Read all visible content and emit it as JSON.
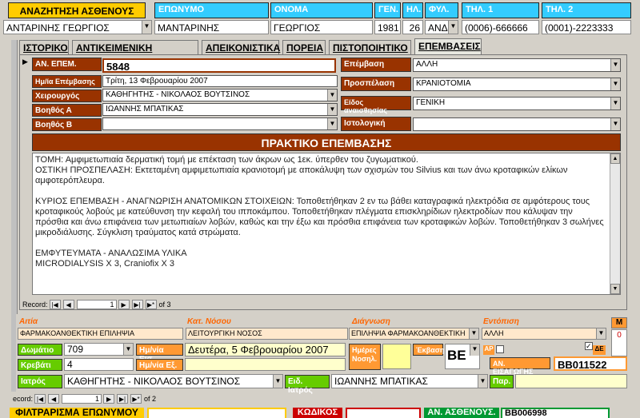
{
  "header": {
    "search_label": "ΑΝΑΖΗΤΗΣΗ ΑΣΘΕΝΟΥΣ",
    "search_value": "ΑΝΤΑΡΙΝΗΣ ΓΕΩΡΓΙΟΣ",
    "cols": {
      "surname": "ΕΠΩΝΥΜΟ",
      "name": "ΟΝΟΜΑ",
      "gen": "ΓΕΝ.",
      "age": "ΗΛ.",
      "sex": "ΦΥΛ.",
      "tel1": "ΤΗΛ. 1",
      "tel2": "ΤΗΛ. 2"
    },
    "values": {
      "surname": "ΜΑΝΤΑΡΙΝΗΣ",
      "name": "ΓΕΩΡΓΙΟΣ",
      "gen": "1981",
      "age": "26",
      "sex": "ΑΝΔΙ",
      "tel1": "(0006)-666666",
      "tel2": "(0001)-2223333"
    }
  },
  "tabs": [
    "ΙΣΤΟΡΙΚΟ",
    "ΑΝΤΙΚΕΙΜΕΝΙΚΗ ΕΞΕΤΑΣΗ",
    "ΑΠΕΙΚΟΝΙΣΤΙΚΑ",
    "ΠΟΡΕΙΑ",
    "ΠΙΣΤΟΠΟΙΗΤΙΚΟ",
    "ΕΠΕΜΒΑΣΕΙΣ"
  ],
  "surgery": {
    "an_epem_label": "ΑΝ. ΕΠΕΜ.",
    "an_epem_value": "5848",
    "date_label": "Ημ/ία Επέμβασης",
    "date_value": "Τρίτη, 13 Φεβρουαρίου 2007",
    "surgeon_label": "Χειρουργός",
    "surgeon_value": "ΚΑΘΗΓΗΤΗΣ - ΝΙΚΟΛΑΟΣ ΒΟΥΤΣΙΝΟΣ",
    "assistA_label": "Βοηθός Α",
    "assistA_value": "ΙΩΑΝΝΗΣ ΜΠΑΤΙΚΑΣ",
    "assistB_label": "Βοηθός Β",
    "assistB_value": "",
    "op_label": "Επέμβαση",
    "op_value": "ΑΛΛΗ",
    "approach_label": "Προσπέλαση",
    "approach_value": "ΚΡΑΝΙΟΤΟΜΙΑ",
    "anesth_label": "Είδος αναισθησίας",
    "anesth_value": "ΓΕΝΙΚΗ",
    "histo_label": "Ιστολογική",
    "histo_value": ""
  },
  "report": {
    "title": "ΠΡΑΚΤΙΚΟ ΕΠΕΜΒΑΣΗΣ",
    "lines": [
      "ΤΟΜΗ: Αμφιμετωπιαία δερματική τομή με επέκταση των άκρων ως 1εκ. ύπερθεν του ζυγωματικού.",
      "ΟΣΤΙΚΗ ΠΡΟΣΠΕΛΑΣΗ: Εκτεταμένη αμφιμετωπιαία κρανιοτομή με αποκάλυψη των σχισμών του Silvius και των άνω κροταφικών ελίκων αμφοτερόπλευρα.",
      "",
      "ΚΥΡΙΟΣ ΕΠΕΜΒΑΣΗ - ΑΝΑΓΝΩΡΙΣΗ ΑΝΑΤΟΜΙΚΩΝ ΣΤΟΙΧΕΙΩΝ: Τοποθετήθηκαν 2 εν τω βάθει καταγραφικά ηλεκτρόδια σε αμφότερους τους κροταφικούς λοβούς με κατεύθυνση την κεφαλή του ιπποκάμπου. Τοποθετήθηκαν πλέγματα επισκληρίδιων ηλεκτροδίων που κάλυψαν την πρόσθια και άνω επιφάνεια των μετωπιαίων λοβών, καθώς και την έξω και πρόσθια επιφάνεια των κροταφικών λοβών. Τοποθετήθηκαν 3 σωλήνες μικροδιάλυσης. Σύγκλιση τραύματος κατά στρώματα.",
      "",
      "ΕΜΦΥΤΕΥΜΑΤΑ - ΑΝΑΛΩΣΙΜΑ ΥΛΙΚΑ",
      "MICRODIALYSIS X 3, Craniofix X 3"
    ]
  },
  "record_nav1": {
    "label": "Record:",
    "current": "1",
    "of": "of 3"
  },
  "bottom": {
    "cause_label": "Αιτία",
    "cause_value": "ΦΑΡΜΑΚΟΑΝΘΕΚΤΙΚΗ ΕΠΙΛΗΨΙΑ",
    "disease_label": "Κατ. Νόσου",
    "disease_value": "ΛΕΙΤΟΥΡΓΙΚΗ ΝΟΣΟΣ",
    "diagnosis_label": "Διάγνωση",
    "diagnosis_value": "ΕΠΙΛΗΨΙΑ ΦΑΡΜΑΚΟΑΝΘΕΚΤΙΚΗ",
    "location_label": "Εντόπιση",
    "location_value": "ΑΛΛΗ",
    "m_label": "Μ",
    "m_value": "0",
    "room_label": "Δωμάτιο",
    "room_value": "709",
    "admit_label": "Ημ/νία Εισ.",
    "admit_value": "Δευτέρα, 5 Φεβρουαρίου 2007",
    "days_label": "Ημέρες Νοσηλ.",
    "outcome_label": "Έκβαση",
    "outcome_value": "ΒΕ",
    "ap_label": "ΑΡ",
    "de_label": "ΔΕ",
    "bed_label": "Κρεβάτι",
    "bed_value": "4",
    "exit_label": "Ημ/νία Εξ.",
    "admission_no_label": "ΑΝ. ΕΙΣΑΓΩΓΗΣ",
    "admission_no_value": "ΒΒ011522",
    "doctor_label": "Ιατρός",
    "doctor_value": "ΚΑΘΗΓΗΤΗΣ - ΝΙΚΟΛΑΟΣ ΒΟΥΤΣΙΝΟΣ",
    "spec_doctor_label": "Ειδ. Ιατρός",
    "spec_doctor_value": "ΙΩΑΝΝΗΣ ΜΠΑΤΙΚΑΣ",
    "par_label": "Παρ."
  },
  "record_nav2": {
    "label": "ecord:",
    "current": "1",
    "of": "of 2"
  },
  "footer": {
    "filter_label": "ΦΙΛΤΡΑΡΙΣΜΑ ΕΠΩΝΥΜΟΥ",
    "code_label": "ΚΩΔΙΚΟΣ",
    "patient_no_label": "ΑΝ. ΑΣΘΕΝΟΥΣ.",
    "patient_no_value": "ΒΒ006998"
  }
}
